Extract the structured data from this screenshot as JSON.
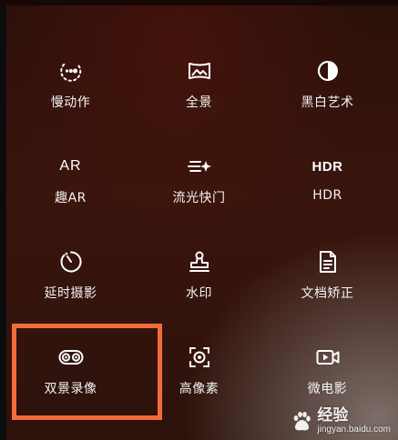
{
  "modes": [
    {
      "label": "慢动作",
      "icon": "slow-motion-icon"
    },
    {
      "label": "全景",
      "icon": "panorama-icon"
    },
    {
      "label": "黑白艺术",
      "icon": "monochrome-icon"
    },
    {
      "label": "趣AR",
      "icon": "ar-icon",
      "icon_text": "AR"
    },
    {
      "label": "流光快门",
      "icon": "light-painting-icon"
    },
    {
      "label": "HDR",
      "icon": "hdr-icon",
      "icon_text": "HDR"
    },
    {
      "label": "延时摄影",
      "icon": "time-lapse-icon"
    },
    {
      "label": "水印",
      "icon": "watermark-stamp-icon"
    },
    {
      "label": "文档矫正",
      "icon": "document-icon"
    },
    {
      "label": "双景录像",
      "icon": "dual-view-icon",
      "highlighted": true
    },
    {
      "label": "高像素",
      "icon": "high-resolution-icon"
    },
    {
      "label": "微电影",
      "icon": "micro-movie-icon"
    }
  ],
  "highlight_color": "#f26b3a",
  "watermark": {
    "brand": "经验",
    "url": "jingyan.baidu.com"
  }
}
